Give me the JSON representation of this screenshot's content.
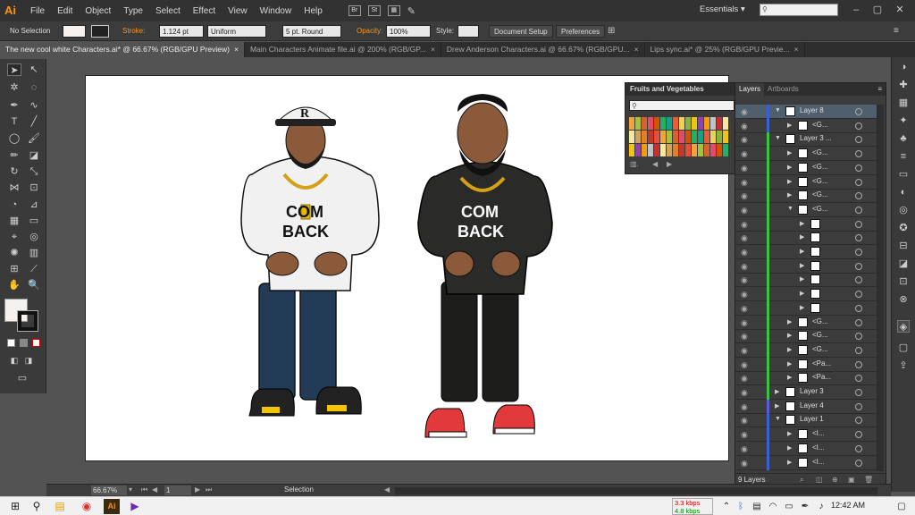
{
  "app": {
    "logo": "Ai"
  },
  "menu": [
    "File",
    "Edit",
    "Object",
    "Type",
    "Select",
    "Effect",
    "View",
    "Window",
    "Help"
  ],
  "menu_icons": [
    "Br",
    "St",
    "arrange-icon",
    "brush-icon"
  ],
  "workspace": {
    "label": "Essentials",
    "search_placeholder": ""
  },
  "control_bar": {
    "selection_label": "No Selection",
    "stroke_label": "Stroke:",
    "stroke_value": "1.124 pt",
    "profile_value": "Uniform",
    "brush_value": "5 pt. Round",
    "opacity_label": "Opacity:",
    "opacity_value": "100%",
    "style_label": "Style:",
    "doc_setup": "Document Setup",
    "preferences": "Preferences"
  },
  "tabs": [
    {
      "label": "The new cool white Characters.ai* @ 66.67% (RGB/GPU Preview)",
      "active": true
    },
    {
      "label": "Main Characters Animate file.ai @ 200% (RGB/GP...",
      "active": false
    },
    {
      "label": "Drew Anderson Characters.ai @ 66.67% (RGB/GPU...",
      "active": false
    },
    {
      "label": "Lips sync.ai* @ 25% (RGB/GPU Previe...",
      "active": false
    }
  ],
  "tab_close": "×",
  "artwork": {
    "left_hoodie_text": [
      "COM",
      "BACK"
    ],
    "right_hoodie_text": [
      "COM",
      "BACK"
    ],
    "cap_letter": "R"
  },
  "swatch_panel": {
    "title": "Fruits and Vegetables"
  },
  "layers_panel": {
    "tabs": [
      "Layers",
      "Artboards"
    ],
    "rows": [
      {
        "name": "Layer 8",
        "level": 0,
        "open": true,
        "selected": true,
        "color": "#3a5fd9"
      },
      {
        "name": "<G...",
        "level": 1,
        "open": false,
        "color": "#3a5fd9"
      },
      {
        "name": "Layer 3 ...",
        "level": 0,
        "open": true,
        "color": "#3ac43a"
      },
      {
        "name": "<G...",
        "level": 1,
        "open": false,
        "color": "#3ac43a"
      },
      {
        "name": "<G...",
        "level": 1,
        "open": false,
        "color": "#3ac43a"
      },
      {
        "name": "<G...",
        "level": 1,
        "open": false,
        "color": "#3ac43a"
      },
      {
        "name": "<G...",
        "level": 1,
        "open": false,
        "color": "#3ac43a"
      },
      {
        "name": "<G...",
        "level": 1,
        "open": true,
        "color": "#3ac43a"
      },
      {
        "name": "",
        "level": 2,
        "open": false,
        "color": "#3ac43a"
      },
      {
        "name": "",
        "level": 2,
        "open": false,
        "color": "#3ac43a"
      },
      {
        "name": "",
        "level": 2,
        "open": false,
        "color": "#3ac43a"
      },
      {
        "name": "",
        "level": 2,
        "open": false,
        "color": "#3ac43a"
      },
      {
        "name": "",
        "level": 2,
        "open": false,
        "color": "#3ac43a"
      },
      {
        "name": "",
        "level": 2,
        "open": false,
        "color": "#3ac43a"
      },
      {
        "name": "",
        "level": 2,
        "open": false,
        "color": "#3ac43a"
      },
      {
        "name": "<G...",
        "level": 1,
        "open": false,
        "color": "#3ac43a"
      },
      {
        "name": "<G...",
        "level": 1,
        "open": false,
        "color": "#3ac43a"
      },
      {
        "name": "<G...",
        "level": 1,
        "open": false,
        "color": "#3ac43a"
      },
      {
        "name": "<Pa...",
        "level": 1,
        "open": false,
        "color": "#3ac43a"
      },
      {
        "name": "<Pa...",
        "level": 1,
        "open": false,
        "color": "#3ac43a"
      },
      {
        "name": "Layer 3",
        "level": 0,
        "open": false,
        "color": "#3ac43a"
      },
      {
        "name": "Layer 4",
        "level": 0,
        "open": false,
        "color": "#5a5ae0"
      },
      {
        "name": "Layer 1",
        "level": 0,
        "open": true,
        "color": "#3a5fd9"
      },
      {
        "name": "<I...",
        "level": 1,
        "open": false,
        "color": "#3a5fd9"
      },
      {
        "name": "<I...",
        "level": 1,
        "open": false,
        "color": "#3a5fd9"
      },
      {
        "name": "<I...",
        "level": 1,
        "open": false,
        "color": "#3a5fd9"
      }
    ],
    "count": "9 Layers"
  },
  "status_bar": {
    "zoom": "66.67%",
    "page": "1",
    "tool": "Selection"
  },
  "taskbar": {
    "net_up": "3.3 kbps",
    "net_down": "4.8 kbps",
    "time": "12:42 AM"
  }
}
